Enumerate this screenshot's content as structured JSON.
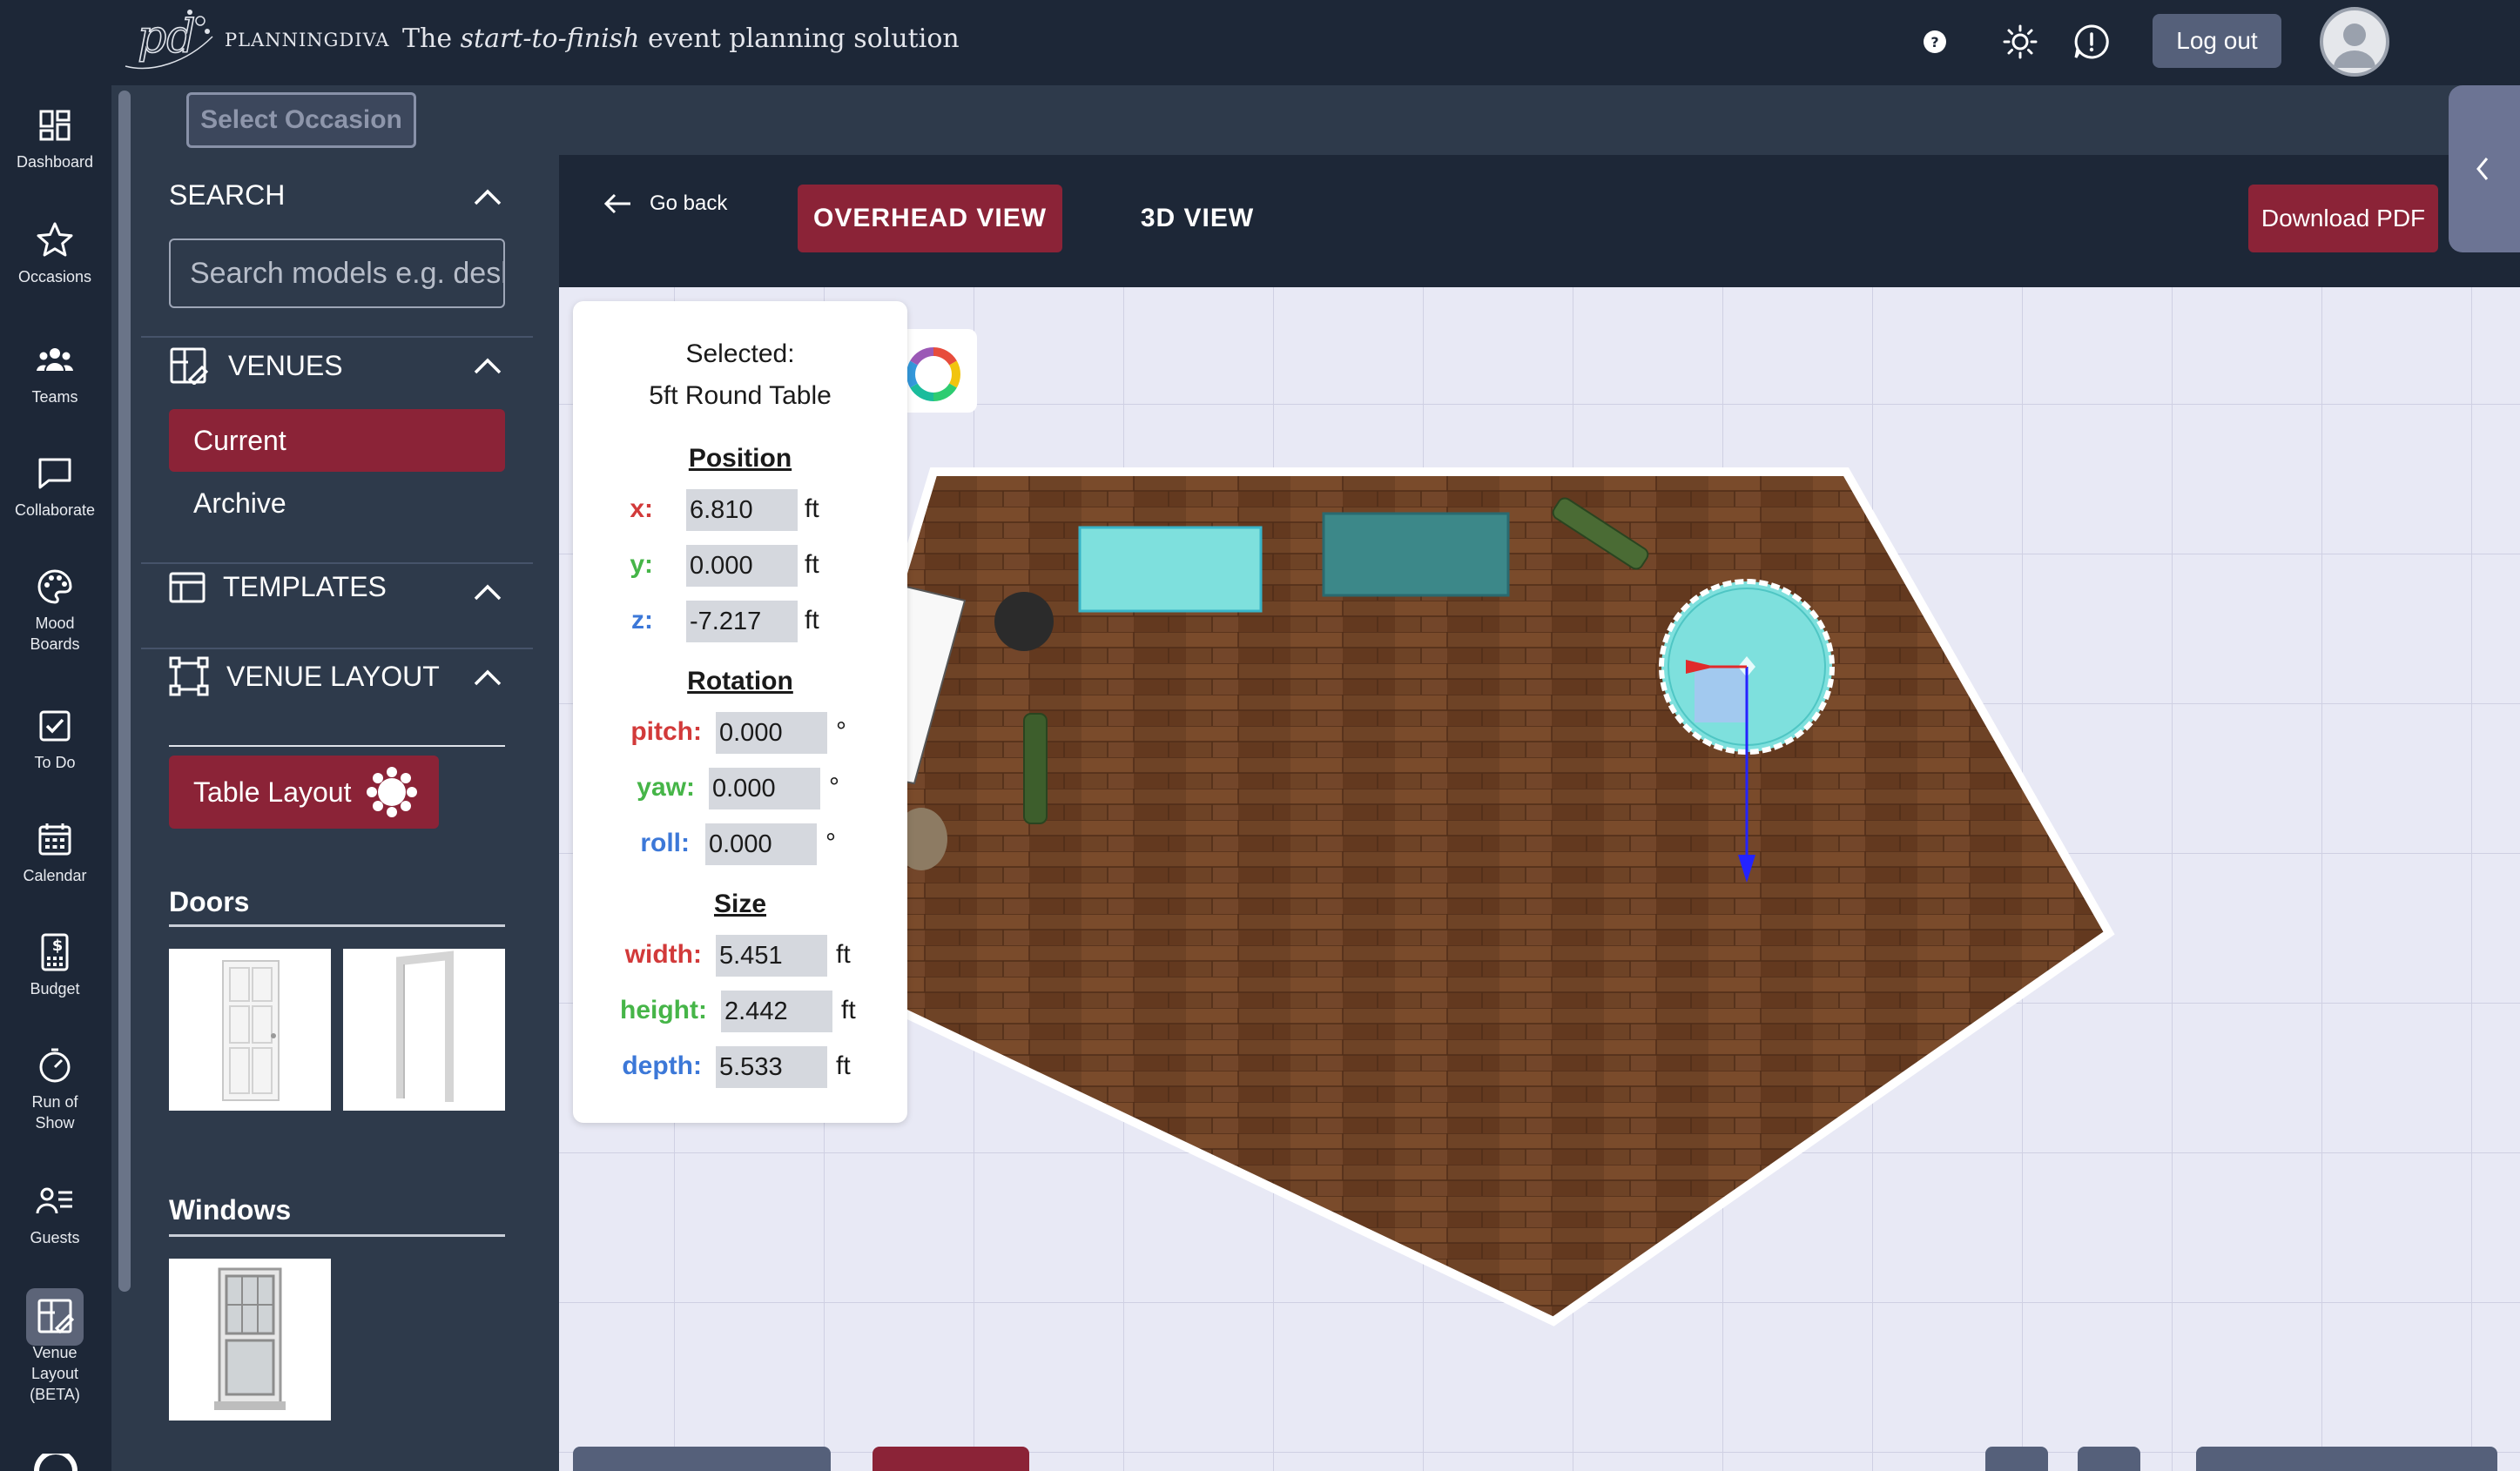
{
  "header": {
    "logo_text": "PLANNINGDIVA",
    "tagline_pre": "The ",
    "tagline_em": "start-to-finish",
    "tagline_post": " event planning solution",
    "logout_label": "Log out"
  },
  "rail": {
    "items": [
      {
        "label": "Dashboard",
        "icon": "dashboard-icon"
      },
      {
        "label": "Occasions",
        "icon": "star-icon"
      },
      {
        "label": "Teams",
        "icon": "users-icon"
      },
      {
        "label": "Collaborate",
        "icon": "chat-icon"
      },
      {
        "label": "Mood Boards",
        "icon": "palette-icon"
      },
      {
        "label": "To Do",
        "icon": "checkbox-icon"
      },
      {
        "label": "Calendar",
        "icon": "calendar-icon"
      },
      {
        "label": "Budget",
        "icon": "budget-icon"
      },
      {
        "label": "Run of Show",
        "icon": "stopwatch-icon"
      },
      {
        "label": "Guests",
        "icon": "guests-icon"
      },
      {
        "label": "Venue Layout (BETA)",
        "icon": "venue-layout-icon"
      }
    ]
  },
  "panel": {
    "select_occasion": "Select Occasion",
    "search_title": "SEARCH",
    "search_placeholder": "Search models e.g. desk",
    "venues_title": "VENUES",
    "venue_current": "Current",
    "venue_archive": "Archive",
    "templates_title": "TEMPLATES",
    "venue_layout_title": "VENUE LAYOUT",
    "table_layout_label": "Table Layout",
    "doors_title": "Doors",
    "windows_title": "Windows"
  },
  "main": {
    "go_back": "Go back",
    "overhead_view": "OVERHEAD VIEW",
    "view_3d": "3D VIEW",
    "download_pdf": "Download PDF"
  },
  "properties": {
    "selected_label": "Selected:",
    "selected_name": "5ft Round Table",
    "position_title": "Position",
    "x_label": "x:",
    "x_value": "6.810",
    "y_label": "y:",
    "y_value": "0.000",
    "z_label": "z:",
    "z_value": "-7.217",
    "rotation_title": "Rotation",
    "pitch_label": "pitch:",
    "pitch_value": "0.000",
    "yaw_label": "yaw:",
    "yaw_value": "0.000",
    "roll_label": "roll:",
    "roll_value": "0.000",
    "size_title": "Size",
    "width_label": "width:",
    "width_value": "5.451",
    "height_label": "height:",
    "height_value": "2.442",
    "depth_label": "depth:",
    "depth_value": "5.533",
    "unit_ft": "ft",
    "unit_deg": "°"
  },
  "colors": {
    "accent": "#8b2337",
    "nav_bg": "#1d2737",
    "panel_bg": "#2e3a4b",
    "canvas_bg": "#e8e9f5",
    "floor": "#6b3f23",
    "selection": "#7ee0dd"
  }
}
